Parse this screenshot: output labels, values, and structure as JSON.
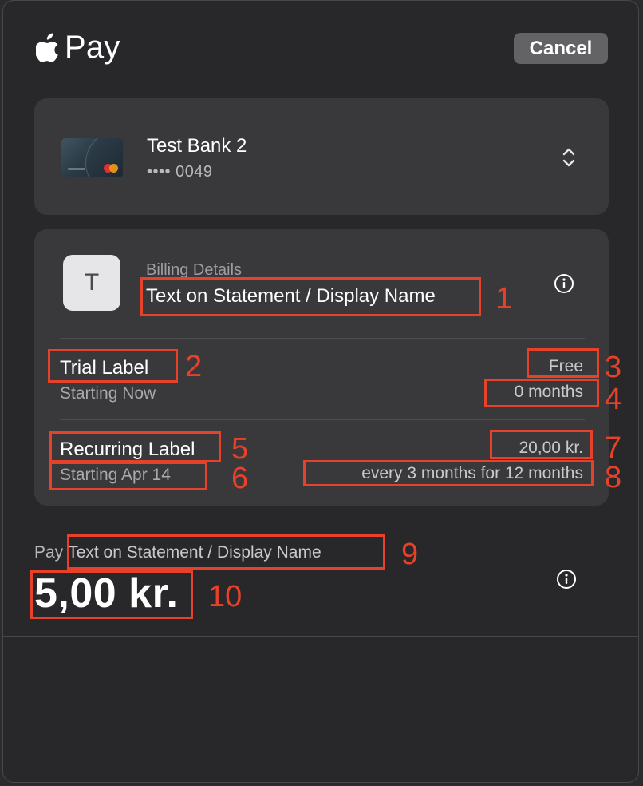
{
  "header": {
    "brand_label": "Pay",
    "cancel_label": "Cancel"
  },
  "card": {
    "name": "Test Bank 2",
    "number": "•••• 0049"
  },
  "billing": {
    "section_title": "Billing Details",
    "avatar_letter": "T",
    "merchant_name": "Text on Statement / Display Name",
    "trial": {
      "label": "Trial Label",
      "start": "Starting Now",
      "amount": "Free",
      "period": "0 months"
    },
    "recurring": {
      "label": "Recurring Label",
      "start": "Starting Apr 14",
      "amount": "20,00 kr.",
      "period": "every 3 months for 12 months"
    }
  },
  "summary": {
    "pay_prefix": "Pay",
    "merchant_name": "Text on Statement / Display Name",
    "amount": "5,00 kr."
  },
  "annotations": [
    "1",
    "2",
    "3",
    "4",
    "5",
    "6",
    "7",
    "8",
    "9",
    "10"
  ],
  "colors": {
    "sheet_bg": "#28282b",
    "panel_bg": "#39393c",
    "cancel_bg": "#636366",
    "annotation": "#e8412a"
  }
}
